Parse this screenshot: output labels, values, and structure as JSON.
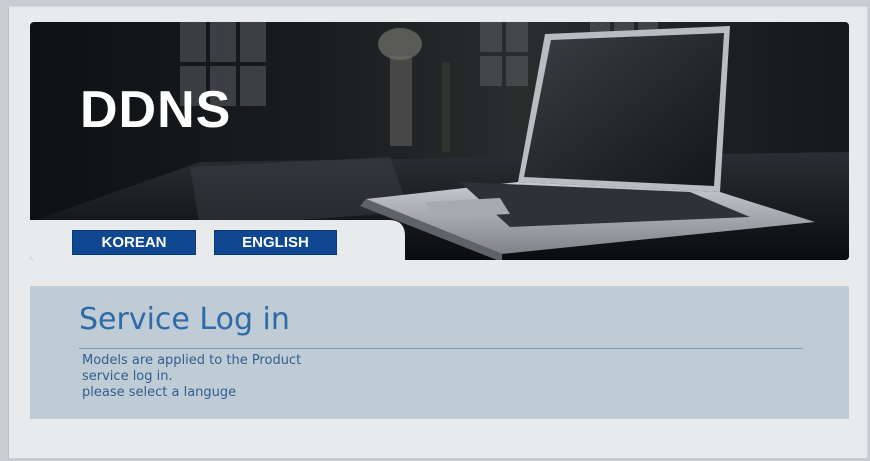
{
  "banner": {
    "brand": "DDNS"
  },
  "languages": {
    "korean_label": "KOREAN",
    "english_label": "ENGLISH"
  },
  "login": {
    "title": "Service Log in",
    "description_lines": [
      "Models are applied to the Product",
      "service log in.",
      "please select a languge"
    ]
  },
  "colors": {
    "button_bg": "#0f4891",
    "panel_bg": "#bfccd6",
    "title_color": "#2d6aa6",
    "page_bg": "#e9eaeb"
  }
}
